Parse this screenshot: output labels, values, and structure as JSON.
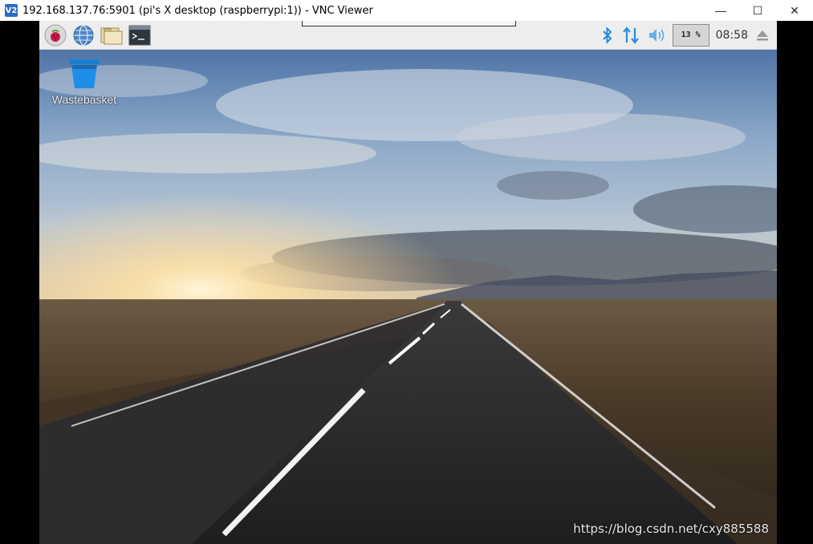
{
  "window": {
    "icon_label": "V2",
    "title": "192.168.137.76:5901 (pi's X desktop (raspberrypi:1)) - VNC Viewer",
    "minimize": "—",
    "maximize": "☐",
    "close": "✕"
  },
  "panel": {
    "launchers": [
      {
        "name": "raspberry-menu-icon"
      },
      {
        "name": "web-browser-icon"
      },
      {
        "name": "file-manager-icon"
      },
      {
        "name": "terminal-icon"
      }
    ],
    "tray": {
      "cpu_usage": "13 %",
      "clock": "08:58"
    }
  },
  "desktop": {
    "icons": [
      {
        "label": "Wastebasket",
        "icon": "trash-icon"
      }
    ]
  },
  "watermark": "https://blog.csdn.net/cxy885588",
  "colors": {
    "panel_bg": "#ededed",
    "bluetooth": "#2b8ad8",
    "sky_top": "#5a7fae",
    "road": "#2a2a2c"
  }
}
